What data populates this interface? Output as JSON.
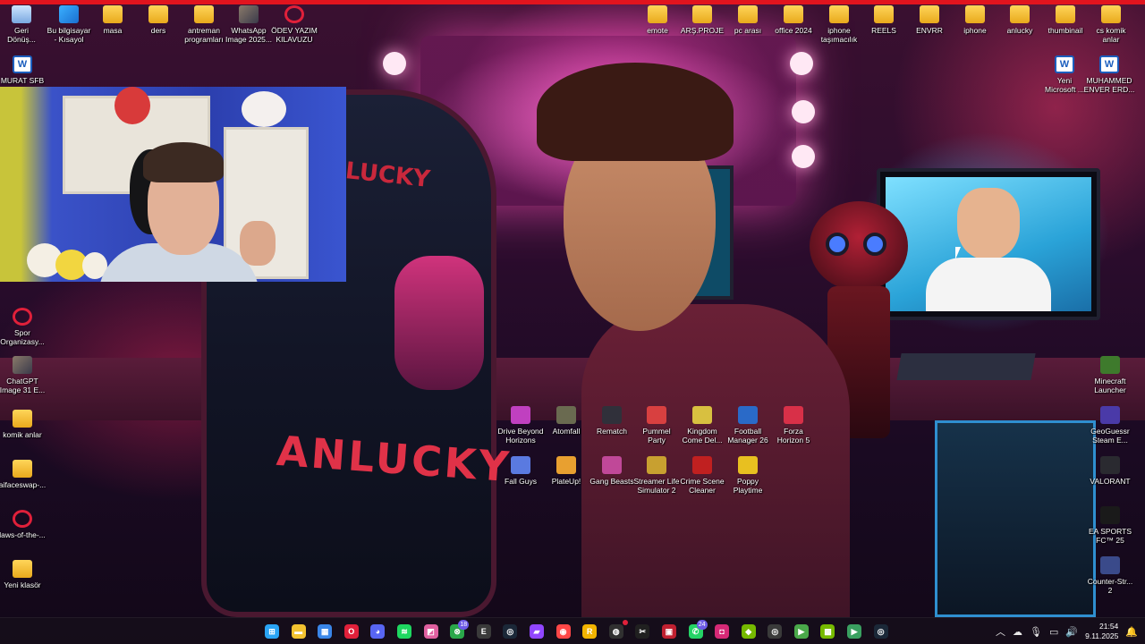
{
  "desktop": {
    "top_icons": [
      {
        "label": "Geri\nDönüş...",
        "icon": "recycle-bin-icon"
      },
      {
        "label": "Bu bilgisayar\n- Kısayol",
        "icon": "this-pc-icon"
      },
      {
        "label": "masa",
        "icon": "folder-icon"
      },
      {
        "label": "ders",
        "icon": "folder-icon"
      },
      {
        "label": "antreman\nprogramları",
        "icon": "folder-icon"
      },
      {
        "label": "WhatsApp\nImage 2025...",
        "icon": "image-icon"
      },
      {
        "label": "ÖDEV YAZIM\nKILAVUZU",
        "icon": "opera-icon"
      },
      {
        "label": "emote",
        "icon": "folder-icon"
      },
      {
        "label": "ARŞ.PROJE",
        "icon": "folder-icon"
      },
      {
        "label": "pc arası",
        "icon": "folder-icon"
      },
      {
        "label": "office 2024",
        "icon": "folder-icon"
      },
      {
        "label": "iphone\ntaşımacılık",
        "icon": "folder-icon"
      },
      {
        "label": "REELS",
        "icon": "folder-icon"
      },
      {
        "label": "ENVRR",
        "icon": "folder-icon"
      },
      {
        "label": "iphone",
        "icon": "folder-icon"
      },
      {
        "label": "anlucky",
        "icon": "folder-icon"
      },
      {
        "label": "thumbinail",
        "icon": "folder-icon"
      },
      {
        "label": "cs komik\nanlar",
        "icon": "folder-icon"
      }
    ],
    "left_icons": [
      {
        "label": "MURAT SFB",
        "icon": "word-icon"
      },
      {
        "label": "Spor\nOrganizasy...",
        "icon": "opera-icon"
      },
      {
        "label": "ChatGPT\nImage 31 E...",
        "icon": "image-icon"
      },
      {
        "label": "komik anlar",
        "icon": "folder-icon"
      },
      {
        "label": "aifaceswap-...",
        "icon": "folder-icon"
      },
      {
        "label": "laws-of-the-...",
        "icon": "opera-icon"
      },
      {
        "label": "Yeni klasör",
        "icon": "folder-icon"
      }
    ],
    "right_icons": [
      {
        "label": "Yeni\nMicrosoft ...",
        "icon": "word-icon"
      },
      {
        "label": "MUHAMMED\nENVER ERD...",
        "icon": "word-icon"
      },
      {
        "label": "Minecraft\nLauncher",
        "icon": "minecraft-icon"
      },
      {
        "label": "GeoGuessr\nSteam E...",
        "icon": "geoguessr-icon"
      },
      {
        "label": "VALORANT",
        "icon": "valorant-icon"
      },
      {
        "label": "EA SPORTS\nFC™ 25",
        "icon": "ea-fc-icon"
      },
      {
        "label": "Counter-Str...\n2",
        "icon": "cs2-icon"
      }
    ],
    "game_icons_row1": [
      {
        "label": "Drive Beyond\nHorizons",
        "icon": "drive-beyond-horizons-icon",
        "color": "#c040c0"
      },
      {
        "label": "Atomfall",
        "icon": "atomfall-icon",
        "color": "#6a6a50"
      },
      {
        "label": "Rematch",
        "icon": "rematch-icon",
        "color": "#30303a"
      },
      {
        "label": "Pummel\nParty",
        "icon": "pummel-party-icon",
        "color": "#d84040"
      },
      {
        "label": "Kingdom\nCome Del...",
        "icon": "kingdom-come-icon",
        "color": "#d8c040"
      },
      {
        "label": "Football\nManager 26",
        "icon": "football-manager-icon",
        "color": "#2a6ac8"
      },
      {
        "label": "Forza\nHorizon 5",
        "icon": "forza-horizon-icon",
        "color": "#d83048"
      }
    ],
    "game_icons_row2": [
      {
        "label": "Fall Guys",
        "icon": "fall-guys-icon",
        "color": "#5a7ae0"
      },
      {
        "label": "PlateUp!",
        "icon": "plateup-icon",
        "color": "#e8a030"
      },
      {
        "label": "Gang Beasts",
        "icon": "gang-beasts-icon",
        "color": "#c04898"
      },
      {
        "label": "Streamer Life\nSimulator 2",
        "icon": "streamer-life-icon",
        "color": "#c8a030"
      },
      {
        "label": "Crime Scene\nCleaner",
        "icon": "crime-scene-cleaner-icon",
        "color": "#c02020"
      },
      {
        "label": "Poppy\nPlaytime",
        "icon": "poppy-playtime-icon",
        "color": "#e8c020"
      }
    ],
    "wallpaper_text": {
      "chair_brand": "ANLUCKY",
      "chair_brand_top": "LUCKY"
    }
  },
  "taskbar": {
    "apps": [
      {
        "icon": "windows-start-icon",
        "glyph": "⊞",
        "color": "#2aa4f4"
      },
      {
        "icon": "file-explorer-icon",
        "glyph": "▬",
        "color": "#f2c230"
      },
      {
        "icon": "microsoft-store-icon",
        "glyph": "▦",
        "color": "#3a86e8"
      },
      {
        "icon": "opera-gx-icon",
        "glyph": "O",
        "color": "#e0203a"
      },
      {
        "icon": "discord-icon",
        "glyph": "◕",
        "color": "#5865f2"
      },
      {
        "icon": "spotify-icon",
        "glyph": "≋",
        "color": "#1ed760"
      },
      {
        "icon": "photos-icon",
        "glyph": "◩",
        "color": "#e060a0"
      },
      {
        "icon": "xbox-icon",
        "glyph": "⊗",
        "color": "#2aa84a",
        "badge": "18"
      },
      {
        "icon": "epic-games-icon",
        "glyph": "E",
        "color": "#3a3a3a"
      },
      {
        "icon": "steam-icon",
        "glyph": "◎",
        "color": "#1b2838"
      },
      {
        "icon": "twitch-icon",
        "glyph": "▰",
        "color": "#9146ff"
      },
      {
        "icon": "ea-app-icon",
        "glyph": "◉",
        "color": "#ff4747"
      },
      {
        "icon": "rockstar-icon",
        "glyph": "R",
        "color": "#f2b400"
      },
      {
        "icon": "obs-icon",
        "glyph": "◍",
        "color": "#303030",
        "badge_dot": true
      },
      {
        "icon": "capcut-icon",
        "glyph": "✂",
        "color": "#202020"
      },
      {
        "icon": "game-launcher-icon",
        "glyph": "▣",
        "color": "#c02030"
      },
      {
        "icon": "whatsapp-icon",
        "glyph": "✆",
        "color": "#25d366",
        "badge": "24"
      },
      {
        "icon": "instagram-icon",
        "glyph": "◘",
        "color": "#d62976"
      },
      {
        "icon": "nvidia-app-icon",
        "glyph": "◆",
        "color": "#76b900"
      },
      {
        "icon": "ubisoft-icon",
        "glyph": "◎",
        "color": "#3a3a3a"
      },
      {
        "icon": "play-icon",
        "glyph": "▶",
        "color": "#4aa84a"
      },
      {
        "icon": "nvidia-icon",
        "glyph": "▩",
        "color": "#76b900"
      },
      {
        "icon": "terminal-play-icon",
        "glyph": "▶",
        "color": "#3aa060"
      },
      {
        "icon": "steam-running-icon",
        "glyph": "◎",
        "color": "#1b2838"
      }
    ],
    "tray": {
      "time": "21:54",
      "date": "9.11.2025"
    }
  }
}
